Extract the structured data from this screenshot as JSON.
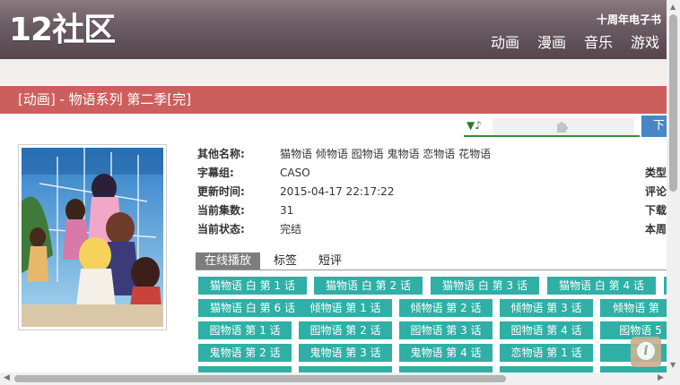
{
  "site": {
    "logo": "12社区",
    "anniversary": "十周年电子书",
    "nav": [
      "动画",
      "漫画",
      "音乐",
      "游戏"
    ]
  },
  "page_title": "[动画] - 物语系列 第二季[完]",
  "player": {
    "note": "▼♪",
    "download_label": "下"
  },
  "info": {
    "rows": [
      {
        "label": "其他名称:",
        "value": "猫物语 倾物语 囮物语 鬼物语 恋物语 花物语"
      },
      {
        "label": "字幕组:",
        "value": "CASO"
      },
      {
        "label": "更新时间:",
        "value": "2015-04-17 22:17:22"
      },
      {
        "label": "当前集数:",
        "value": "31"
      },
      {
        "label": "当前状态:",
        "value": "完结"
      }
    ],
    "side_labels": [
      "类型",
      "评论",
      "下载",
      "本周"
    ]
  },
  "tabs": [
    "在线播放",
    "标签",
    "短评"
  ],
  "episodes": [
    [
      "猫物语 白 第 1 话",
      "猫物语 白 第 2 话",
      "猫物语 白 第 3 话",
      "猫物语 白 第 4 话",
      ""
    ],
    [
      "猫物语 白 第 6 话",
      "倾物语 第 1 话",
      "倾物语 第 2 话",
      "倾物语 第 3 话",
      "倾物语 第"
    ],
    [
      "囮物语 第 1 话",
      "囮物语 第 2 话",
      "囮物语 第 3 话",
      "囮物语 第 4 话",
      "囮物语 5"
    ],
    [
      "鬼物语 第 2 话",
      "鬼物语 第 3 话",
      "鬼物语 第 4 话",
      "恋物语 第 1 话",
      "恋物"
    ],
    [
      "",
      "",
      "",
      "",
      ""
    ]
  ],
  "colors": {
    "header": "#6b5b62",
    "title_bar": "#cc5f5e",
    "episode_button": "#2fafa5",
    "tab_active": "#7d7d7d",
    "download_button": "#4a86c5"
  },
  "icons": {
    "player_plugin": "puzzle-icon",
    "info_button": "info-icon"
  }
}
